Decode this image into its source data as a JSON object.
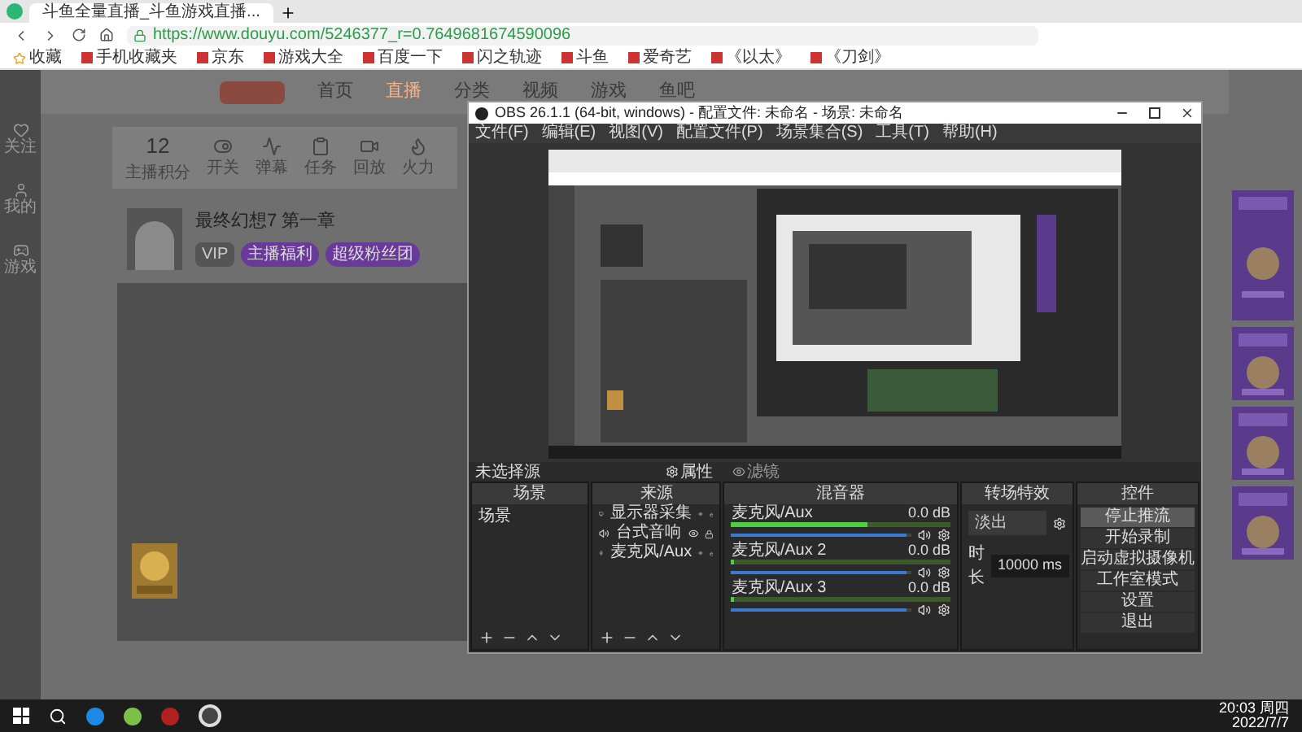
{
  "browser": {
    "tab_title": "斗鱼全量直播_斗鱼游戏直播...",
    "url": "https://www.douyu.com/5246377_r=0.7649681674590096",
    "bookmarks": [
      "收藏",
      "手机收藏夹",
      "京东",
      "游戏大全",
      "百度一下",
      "闪之轨迹",
      "斗鱼",
      "爱奇艺",
      "《以太》",
      "《刀剑》"
    ]
  },
  "douyu": {
    "nav": [
      {
        "label": "首页",
        "selected": false
      },
      {
        "label": "直播",
        "selected": true
      },
      {
        "label": "分类",
        "selected": false
      },
      {
        "label": "视频",
        "selected": false
      },
      {
        "label": "游戏",
        "selected": false
      },
      {
        "label": "鱼吧",
        "selected": false
      }
    ],
    "sidebar": [
      "关注",
      "我的",
      "游戏"
    ],
    "stats": {
      "score": "12",
      "score_label": "主播积分",
      "items": [
        "开关",
        "弹幕",
        "任务",
        "回放",
        "火力"
      ]
    },
    "room": {
      "title": "最终幻想7 第一章",
      "badge": "VIP",
      "tags": [
        "主播福利",
        "超级粉丝团"
      ]
    }
  },
  "obs": {
    "title": "OBS 26.1.1 (64-bit, windows) - 配置文件: 未命名 - 场景: 未命名",
    "menu": [
      "文件(F)",
      "编辑(E)",
      "视图(V)",
      "配置文件(P)",
      "场景集合(S)",
      "工具(T)",
      "帮助(H)"
    ],
    "source_label": "未选择源",
    "properties": "属性",
    "filters": "滤镜",
    "scenes": {
      "title": "场景",
      "items": [
        {
          "name": "场景",
          "selected": false
        }
      ]
    },
    "sources": {
      "title": "来源",
      "items": [
        {
          "name": "显示器采集",
          "kind": "display"
        },
        {
          "name": "台式音响",
          "kind": "audio"
        },
        {
          "name": "麦克风/Aux",
          "kind": "mic"
        }
      ]
    },
    "mixer": {
      "title": "混音器",
      "channels": [
        {
          "name": "麦克风/Aux",
          "reading": "0.0 dB",
          "level": 0.62,
          "volume": {
            "level": 0.97
          }
        },
        {
          "name": "麦克风/Aux 2",
          "reading": "0.0 dB",
          "level": 0.0,
          "volume": {
            "level": 0.97
          }
        },
        {
          "name": "麦克风/Aux 3",
          "reading": "0.0 dB",
          "level": 0.0,
          "volume": {
            "level": 0.97
          }
        }
      ]
    },
    "transitions": {
      "title": "转场特效",
      "type": "淡出",
      "duration_label": "时长",
      "duration": "10000 ms"
    },
    "controls": {
      "title": "控件",
      "buttons": [
        {
          "label": "停止推流",
          "active": true
        },
        {
          "label": "开始录制",
          "active": false
        },
        {
          "label": "启动虚拟摄像机",
          "active": false
        },
        {
          "label": "工作室模式",
          "active": false
        },
        {
          "label": "设置",
          "active": false
        },
        {
          "label": "退出",
          "active": false
        }
      ]
    }
  },
  "taskbar": {
    "time": "20:03 周四",
    "date": "2022/7/7"
  }
}
